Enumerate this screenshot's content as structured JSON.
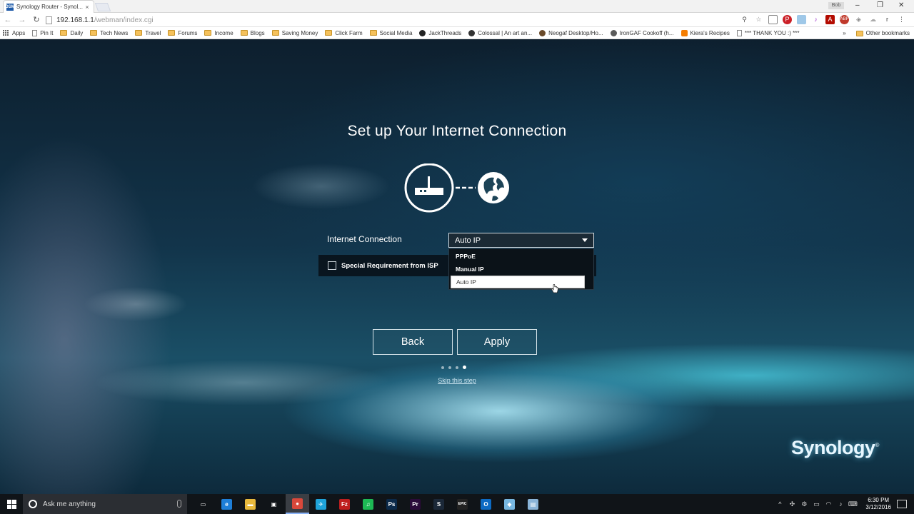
{
  "browser": {
    "tab_title": "Synology Router - Synol...",
    "tab_favicon": "DSM",
    "tab_close": "×",
    "user_badge": "Bob",
    "url_host": "192.168.1.1",
    "url_path": "/webman/index.cgi",
    "bookmarks": [
      {
        "label": "Apps",
        "icon": "apps-icon"
      },
      {
        "label": "Pin It",
        "icon": "page-icon"
      },
      {
        "label": "Daily",
        "icon": "folder-icon"
      },
      {
        "label": "Tech News",
        "icon": "folder-icon"
      },
      {
        "label": "Travel",
        "icon": "folder-icon"
      },
      {
        "label": "Forums",
        "icon": "folder-icon"
      },
      {
        "label": "Income",
        "icon": "folder-icon"
      },
      {
        "label": "Blogs",
        "icon": "folder-icon"
      },
      {
        "label": "Saving Money",
        "icon": "folder-icon"
      },
      {
        "label": "Click Farm",
        "icon": "folder-icon"
      },
      {
        "label": "Social Media",
        "icon": "folder-icon"
      },
      {
        "label": "JackThreads",
        "icon": "jackthreads-icon"
      },
      {
        "label": "Colossal | An art an...",
        "icon": "colossal-icon"
      },
      {
        "label": "Neogaf Desktop/Ho...",
        "icon": "neogaf-icon"
      },
      {
        "label": "IronGAF Cookoff (h...",
        "icon": "irongaf-icon"
      },
      {
        "label": "Kiera's Recipes",
        "icon": "blogger-icon"
      },
      {
        "label": "*** THANK YOU :) ***",
        "icon": "page-icon"
      }
    ],
    "bookmarks_overflow": "»",
    "other_bookmarks": "Other bookmarks"
  },
  "page": {
    "title": "Set up Your Internet Connection",
    "connection_label": "Internet Connection",
    "connection_selected": "Auto IP",
    "dropdown_options": [
      "PPPoE",
      "Manual IP",
      "Auto IP"
    ],
    "isp_label": "Special Requirement from ISP",
    "back_label": "Back",
    "apply_label": "Apply",
    "steps_total": 4,
    "steps_active": 4,
    "skip_label": "Skip this step",
    "brand": "Synology",
    "brand_mark": "®"
  },
  "taskbar": {
    "search_placeholder": "Ask me anything",
    "apps": [
      {
        "name": "task-view-icon",
        "glyph": "▭",
        "color": "#101418"
      },
      {
        "name": "edge-icon",
        "glyph": "e",
        "color": "#1e7fd8"
      },
      {
        "name": "file-explorer-icon",
        "glyph": "▬",
        "color": "#e8b93c"
      },
      {
        "name": "store-icon",
        "glyph": "▣",
        "color": "#101418"
      },
      {
        "name": "chrome-icon",
        "glyph": "●",
        "color": "#d9483b"
      },
      {
        "name": "pin-app-icon",
        "glyph": "✈",
        "color": "#1fa3d9"
      },
      {
        "name": "filezilla-icon",
        "glyph": "Fz",
        "color": "#bf1e1e"
      },
      {
        "name": "spotify-icon",
        "glyph": "♫",
        "color": "#1db954"
      },
      {
        "name": "photoshop-icon",
        "glyph": "Ps",
        "color": "#0b2a4a"
      },
      {
        "name": "premiere-icon",
        "glyph": "Pr",
        "color": "#2b0b3a"
      },
      {
        "name": "steam-icon",
        "glyph": "S",
        "color": "#1b2838"
      },
      {
        "name": "epic-icon",
        "glyph": "EPIC",
        "color": "#222"
      },
      {
        "name": "outlook-icon",
        "glyph": "O",
        "color": "#0d6bc4"
      },
      {
        "name": "notes-icon",
        "glyph": "◆",
        "color": "#78b7e0"
      },
      {
        "name": "window-app-icon",
        "glyph": "▤",
        "color": "#8ab4d8"
      }
    ],
    "time": "6:30 PM",
    "date": "3/12/2016"
  }
}
